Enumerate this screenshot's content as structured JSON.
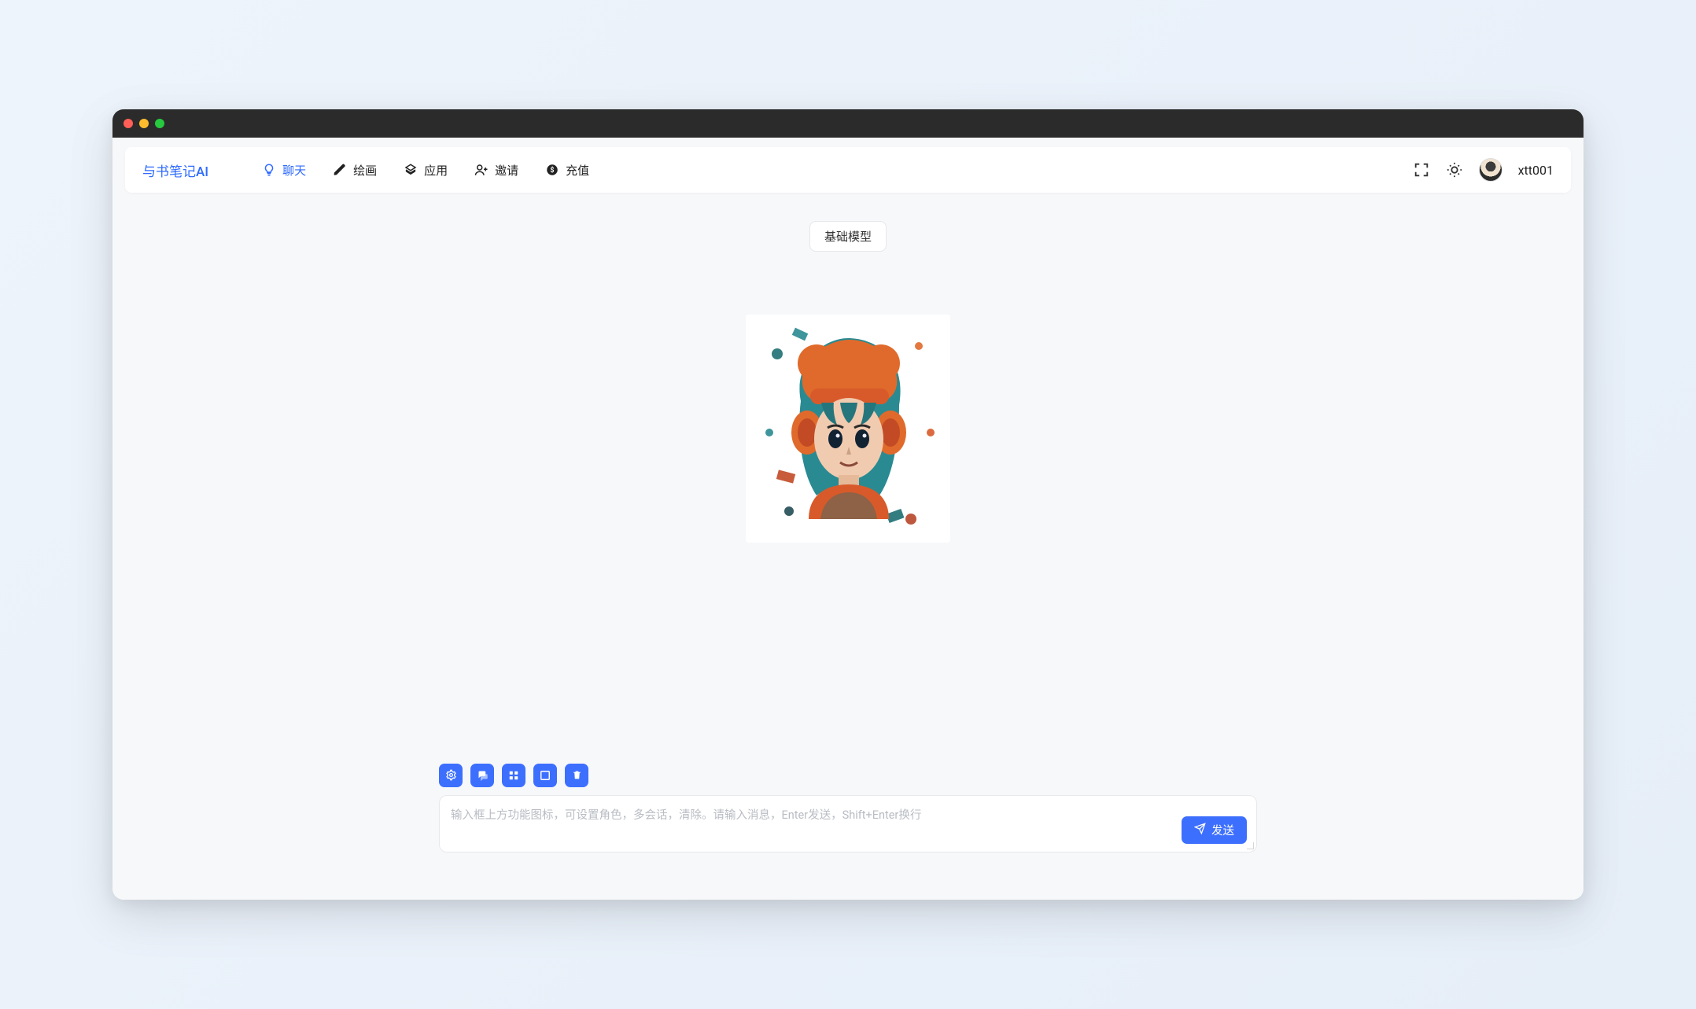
{
  "brand": "与书笔记AI",
  "nav": {
    "items": [
      {
        "label": "聊天",
        "icon": "bulb-icon",
        "active": true
      },
      {
        "label": "绘画",
        "icon": "pencil-icon",
        "active": false
      },
      {
        "label": "应用",
        "icon": "apps-icon",
        "active": false
      },
      {
        "label": "邀请",
        "icon": "invite-icon",
        "active": false
      },
      {
        "label": "充值",
        "icon": "coin-icon",
        "active": false
      }
    ]
  },
  "user": {
    "name": "xtt001"
  },
  "model_chip": "基础模型",
  "toolbar_icons": [
    "gear-icon",
    "chat-bubbles-icon",
    "apps-small-icon",
    "expand-icon",
    "trash-icon"
  ],
  "input": {
    "placeholder": "输入框上方功能图标，可设置角色，多会话，清除。请输入消息，Enter发送，Shift+Enter换行"
  },
  "send_label": "发送"
}
